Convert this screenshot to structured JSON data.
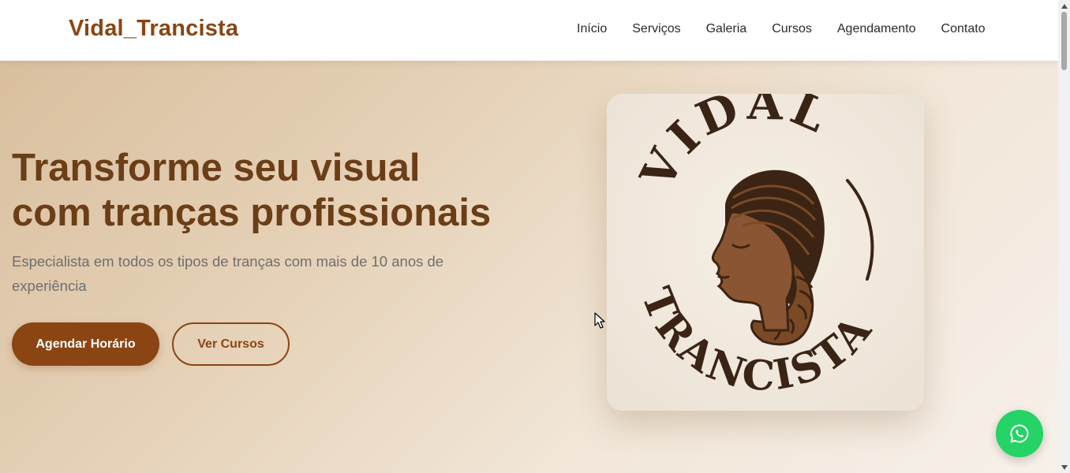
{
  "header": {
    "brand": "Vidal_Trancista",
    "nav": [
      {
        "label": "Início"
      },
      {
        "label": "Serviços"
      },
      {
        "label": "Galeria"
      },
      {
        "label": "Cursos"
      },
      {
        "label": "Agendamento"
      },
      {
        "label": "Contato"
      }
    ]
  },
  "hero": {
    "title_line1": "Transforme seu visual",
    "title_line2": "com tranças profissionais",
    "subtitle": "Especialista em todos os tipos de tranças com mais de 10 anos de experiência",
    "primary_button": "Agendar Horário",
    "secondary_button": "Ver Cursos"
  },
  "logo": {
    "top_text": "VIDAL",
    "bottom_text": "TRANCISTA"
  },
  "floating": {
    "icon": "whatsapp-icon"
  },
  "colors": {
    "brand": "#8b4513",
    "whatsapp": "#25d366"
  }
}
